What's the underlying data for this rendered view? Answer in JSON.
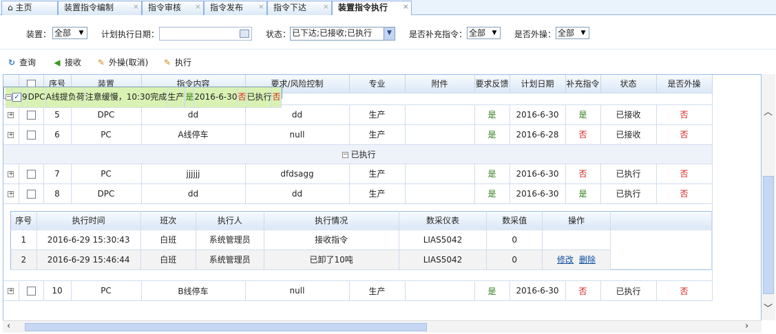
{
  "tabs": [
    {
      "label": "主页",
      "icon": "home-icon"
    },
    {
      "label": "装置指令编制"
    },
    {
      "label": "指令审核"
    },
    {
      "label": "指令发布"
    },
    {
      "label": "指令下达"
    },
    {
      "label": "装置指令执行",
      "active": true
    }
  ],
  "filters": {
    "device_label": "装置：",
    "device_value": "全部",
    "date_label": "计划执行日期：",
    "date_value": "",
    "status_label": "状态：",
    "status_value": "已下达;已接收;已执行",
    "supplement_label": "是否补充指令：",
    "supplement_value": "全部",
    "external_label": "是否外操：",
    "external_value": "全部"
  },
  "toolbar": {
    "query": "查询",
    "receive": "接收",
    "external_cancel": "外操(取消)",
    "execute": "执行"
  },
  "columns": [
    "序号",
    "装置",
    "指令内容",
    "要求/风险控制",
    "专业",
    "附件",
    "要求反馈",
    "计划日期",
    "补充指令",
    "状态",
    "是否外操"
  ],
  "rows_top": [
    {
      "seq": "5",
      "device": "DPC",
      "content": "dd",
      "requirement": "dd",
      "major": "生产",
      "attach": "",
      "feedback": "是",
      "date": "2016-6-30",
      "supplement": "是",
      "status": "已接收",
      "external": "否"
    },
    {
      "seq": "6",
      "device": "PC",
      "content": "A线停车",
      "requirement": "null",
      "major": "生产",
      "attach": "",
      "feedback": "是",
      "date": "2016-6-28",
      "supplement": "否",
      "status": "已接收",
      "external": "否"
    }
  ],
  "group": {
    "label": "已执行"
  },
  "rows_executed": [
    {
      "seq": "7",
      "device": "PC",
      "content": "jjjjjj",
      "requirement": "dfdsagg",
      "major": "生产",
      "attach": "",
      "feedback": "是",
      "date": "2016-6-30",
      "supplement": "否",
      "status": "已执行",
      "external": "否"
    },
    {
      "seq": "8",
      "device": "DPC",
      "content": "dd",
      "requirement": "dd",
      "major": "生产",
      "attach": "",
      "feedback": "是",
      "date": "2016-6-30",
      "supplement": "是",
      "status": "已执行",
      "external": "否"
    },
    {
      "seq": "9",
      "device": "DPC",
      "content": "A线提负荷",
      "requirement": "注意缓慢，10:30完成",
      "major": "生产",
      "attach": "",
      "feedback": "是",
      "date": "2016-6-30",
      "supplement": "否",
      "status": "已执行",
      "external": "否",
      "checked": true
    }
  ],
  "detail": {
    "columns": [
      "序号",
      "执行时间",
      "班次",
      "执行人",
      "执行情况",
      "数采仪表",
      "数采值",
      "操作"
    ],
    "rows": [
      {
        "seq": "1",
        "time": "2016-6-29 15:30:43",
        "shift": "白班",
        "person": "系统管理员",
        "situation": "接收指令",
        "meter": "LIAS5042",
        "value": "0",
        "edit": "",
        "delete": ""
      },
      {
        "seq": "2",
        "time": "2016-6-29 15:46:44",
        "shift": "白班",
        "person": "系统管理员",
        "situation": "已卸了10吨",
        "meter": "LIAS5042",
        "value": "0",
        "edit": "修改",
        "delete": "删除"
      }
    ]
  },
  "rows_bottom": [
    {
      "seq": "10",
      "device": "PC",
      "content": "B线停车",
      "requirement": "null",
      "major": "生产",
      "attach": "",
      "feedback": "是",
      "date": "2016-6-30",
      "supplement": "否",
      "status": "已执行",
      "external": "否"
    }
  ]
}
